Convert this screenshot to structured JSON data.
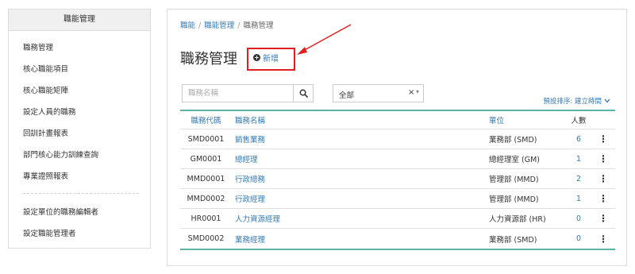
{
  "sidebar": {
    "title": "職能管理",
    "items": [
      {
        "label": "職務管理"
      },
      {
        "label": "核心職能項目"
      },
      {
        "label": "核心職能矩陣"
      },
      {
        "label": "設定人員的職務"
      },
      {
        "label": "回訓計畫報表"
      },
      {
        "label": "部門核心能力訓練查詢"
      },
      {
        "label": "專業證照報表"
      },
      {
        "label": "設定單位的職務編輯者"
      },
      {
        "label": "設定職能管理者"
      }
    ]
  },
  "breadcrumb": {
    "items": [
      "職能",
      "職能管理"
    ],
    "separator": "/",
    "current": "職務管理"
  },
  "page": {
    "title": "職務管理",
    "add_label": "新增"
  },
  "search": {
    "placeholder": "職務名稱",
    "value": ""
  },
  "filter": {
    "selected": "全部",
    "clear": "×",
    "caret": "▾"
  },
  "sort": {
    "label": "預設排序: 建立時間"
  },
  "table": {
    "headers": {
      "code": "職務代碼",
      "name": "職務名稱",
      "unit": "單位",
      "count": "人數"
    },
    "rows": [
      {
        "code": "SMD0001",
        "name": "銷售業務",
        "unit": "業務部 (SMD)",
        "count": "6"
      },
      {
        "code": "GM0001",
        "name": "總經理",
        "unit": "總經理室 (GM)",
        "count": "1"
      },
      {
        "code": "MMD0001",
        "name": "行政總務",
        "unit": "管理部 (MMD)",
        "count": "2"
      },
      {
        "code": "MMD0002",
        "name": "行政經理",
        "unit": "管理部 (MMD)",
        "count": "1"
      },
      {
        "code": "HR0001",
        "name": "人力資源經理",
        "unit": "人力資源部 (HR)",
        "count": "0"
      },
      {
        "code": "SMD0002",
        "name": "業務經理",
        "unit": "業務部 (SMD)",
        "count": "0"
      }
    ]
  },
  "icons": {
    "more": "⋮",
    "plus": "+"
  },
  "colors": {
    "link": "#337ab7",
    "table_border": "#5cb3a8",
    "highlight": "#e02020"
  }
}
